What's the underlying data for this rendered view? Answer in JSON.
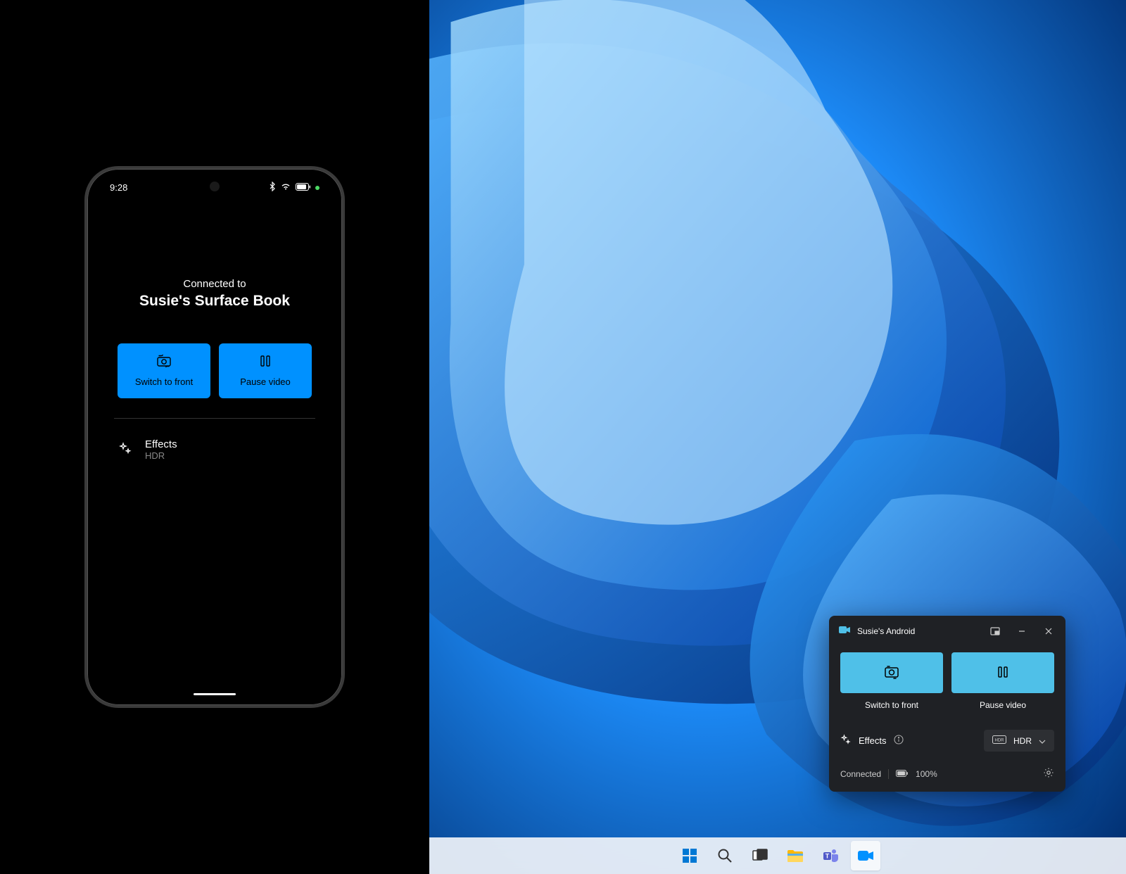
{
  "phone": {
    "status": {
      "time": "9:28"
    },
    "connected_label": "Connected to",
    "device_name": "Susie's Surface Book",
    "buttons": {
      "switch_label": "Switch to front",
      "pause_label": "Pause video"
    },
    "effects": {
      "title": "Effects",
      "value": "HDR"
    }
  },
  "widget": {
    "title": "Susie's Android",
    "buttons": {
      "switch_label": "Switch to front",
      "pause_label": "Pause video"
    },
    "effects_label": "Effects",
    "hdr_label": "HDR",
    "status": "Connected",
    "battery": "100%"
  },
  "icons": {
    "camera": "camera-icon",
    "sparkle": "sparkle-icon",
    "switch_camera": "switch-camera-icon",
    "pause": "pause-icon",
    "bluetooth": "bluetooth-icon",
    "wifi": "wifi-icon",
    "battery": "battery-icon",
    "picture_in_picture": "picture-in-picture-icon",
    "minimize": "minimize-icon",
    "close": "close-icon",
    "info": "info-icon",
    "hdr_badge": "hdr-badge-icon",
    "chevron_down": "chevron-down-icon",
    "gear": "gear-icon",
    "windows": "windows-start-icon",
    "search": "search-icon",
    "task_view": "task-view-icon",
    "explorer": "file-explorer-icon",
    "teams": "teams-icon"
  }
}
